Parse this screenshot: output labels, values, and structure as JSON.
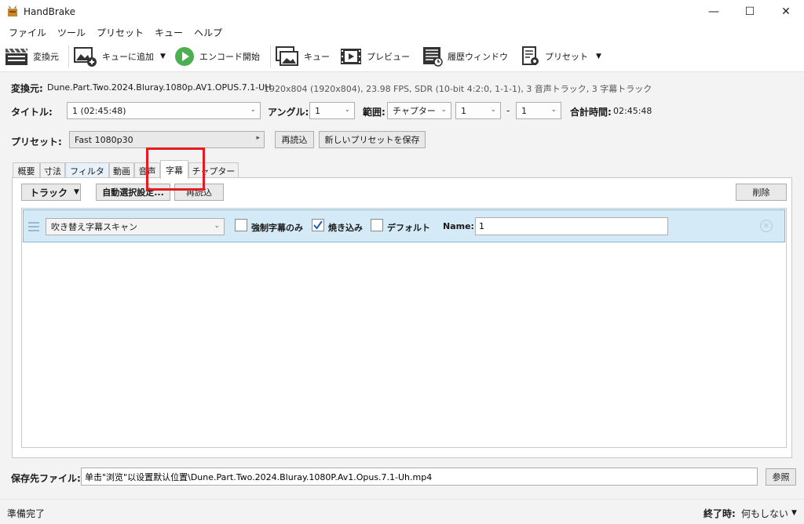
{
  "window": {
    "title": "HandBrake",
    "controls": {
      "minimize": "—",
      "maximize": "☐",
      "close": "✕"
    }
  },
  "menu": [
    "ファイル",
    "ツール",
    "プリセット",
    "キュー",
    "ヘルプ"
  ],
  "toolbar": {
    "source": "変換元",
    "add_queue": "キューに追加",
    "start": "エンコード開始",
    "queue": "キュー",
    "preview": "プレビュー",
    "activity": "履歴ウィンドウ",
    "presets": "プリセット"
  },
  "source": {
    "label": "変換元:",
    "name": "Dune.Part.Two.2024.Bluray.1080p.AV1.OPUS.7.1-UH",
    "info": "1920x804 (1920x804), 23.98 FPS, SDR (10-bit 4:2:0, 1-1-1), 3 音声トラック, 3 字幕トラック"
  },
  "title_row": {
    "title_label": "タイトル:",
    "title_value": "1 (02:45:48)",
    "angle_label": "アングル:",
    "angle_value": "1",
    "range_label": "範囲:",
    "range_type": "チャプター",
    "range_start": "1",
    "range_dash": "-",
    "range_end": "1",
    "duration_label": "合計時間:",
    "duration_value": "02:45:48"
  },
  "preset_row": {
    "label": "プリセット:",
    "value": "Fast 1080p30",
    "reload": "再読込",
    "save_new": "新しいプリセットを保存"
  },
  "tabs": [
    "概要",
    "寸法",
    "フィルタ",
    "動画",
    "音声",
    "字幕",
    "チャプター"
  ],
  "subtitles": {
    "tracks_btn": "トラック",
    "auto_select": "自動選択設定...",
    "reload": "再読込",
    "remove": "削除",
    "row": {
      "track": "吹き替え字幕スキャン",
      "forced_only": "強制字幕のみ",
      "forced_checked": false,
      "burn_in": "焼き込み",
      "burn_checked": true,
      "default": "デフォルト",
      "default_checked": false,
      "name_label": "Name:",
      "name_value": "1"
    }
  },
  "destination": {
    "label": "保存先ファイル:",
    "path": "单击\"浏览\"以设置默认位置\\Dune.Part.Two.2024.Bluray.1080P.Av1.Opus.7.1-Uh.mp4",
    "browse": "参照"
  },
  "status": {
    "text": "準備完了",
    "when_done_label": "終了時:",
    "when_done_value": "何もしない"
  },
  "colors": {
    "accent": "#e51b24",
    "selected_row": "#d5eaf7",
    "start_button": "#4caf50"
  }
}
